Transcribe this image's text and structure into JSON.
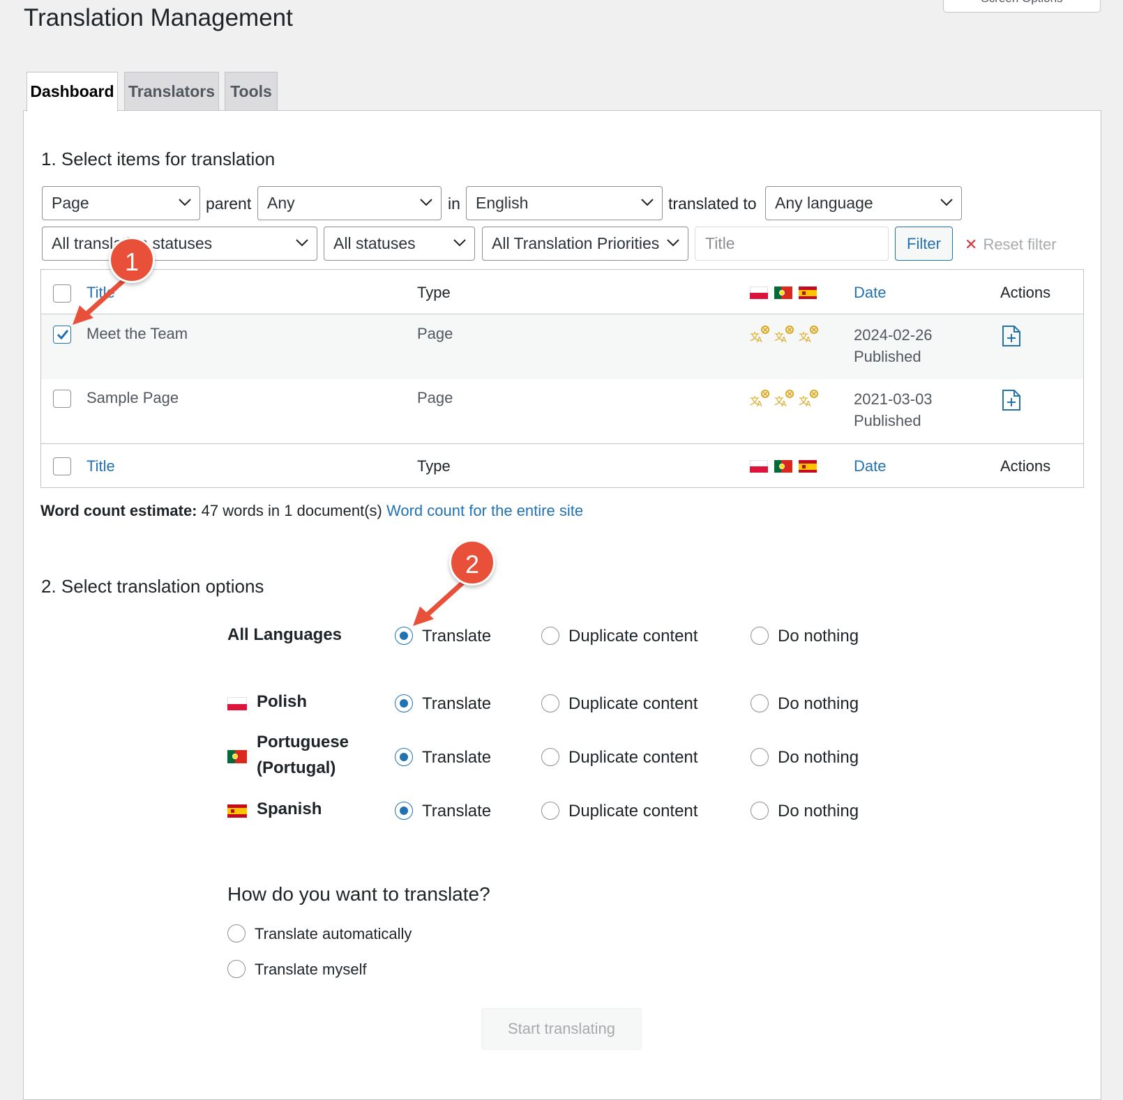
{
  "page": {
    "title": "Translation Management",
    "screen_options": "Screen Options"
  },
  "tabs": [
    {
      "label": "Dashboard"
    },
    {
      "label": "Translators"
    },
    {
      "label": "Tools"
    }
  ],
  "section1": {
    "heading": "1. Select items for translation",
    "filters": {
      "post_type": "Page",
      "parent_label": "parent",
      "parent": "Any",
      "in_label": "in",
      "language": "English",
      "translated_to_label": "translated to",
      "target_language": "Any language",
      "translation_status": "All translation statuses",
      "status": "All statuses",
      "priority": "All Translation Priorities",
      "title_placeholder": "Title",
      "filter_button": "Filter",
      "reset_filter": "Reset filter"
    },
    "table": {
      "columns": {
        "title": "Title",
        "type": "Type",
        "date": "Date",
        "actions": "Actions"
      },
      "language_flags": [
        "pl-flag-icon",
        "pt-flag-icon",
        "es-flag-icon"
      ],
      "rows": [
        {
          "title": "Meet the Team",
          "type": "Page",
          "date": "2024-02-26",
          "status": "Published",
          "checked": true
        },
        {
          "title": "Sample Page",
          "type": "Page",
          "date": "2021-03-03",
          "status": "Published",
          "checked": false
        }
      ]
    },
    "word_count": {
      "label": "Word count estimate:",
      "text": "47 words in 1 document(s)",
      "link": "Word count for the entire site"
    }
  },
  "section2": {
    "heading": "2. Select translation options",
    "options": {
      "translate": "Translate",
      "duplicate": "Duplicate content",
      "nothing": "Do nothing"
    },
    "languages": [
      {
        "label": "All Languages",
        "selected": "translate"
      },
      {
        "label": "Polish",
        "flag": "pl-flag-icon",
        "selected": "translate"
      },
      {
        "label": "Portuguese (Portugal)",
        "label_line1": "Portuguese",
        "label_line2": "(Portugal)",
        "flag": "pt-flag-icon",
        "selected": "translate"
      },
      {
        "label": "Spanish",
        "flag": "es-flag-icon",
        "selected": "translate"
      }
    ],
    "how_heading": "How do you want to translate?",
    "how_options": [
      "Translate automatically",
      "Translate myself"
    ],
    "start_button": "Start translating"
  },
  "annotations": {
    "badge1": "1",
    "badge2": "2"
  },
  "colors": {
    "accent": "#2271b1",
    "badge": "#e8503a",
    "translate_icon": "#dba617"
  }
}
